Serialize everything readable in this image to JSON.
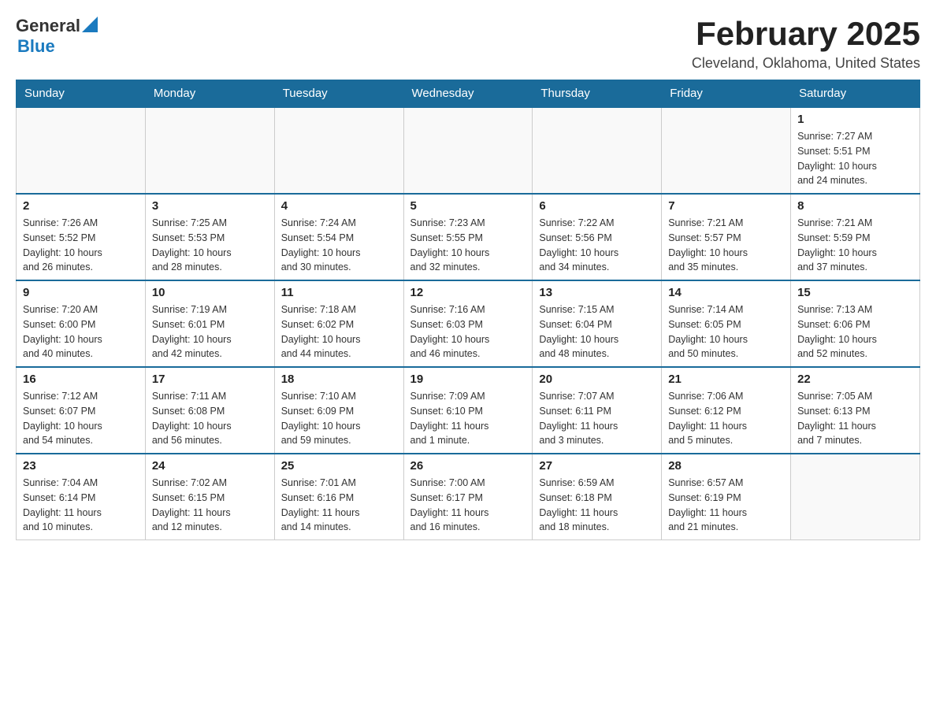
{
  "header": {
    "logo_general": "General",
    "logo_blue": "Blue",
    "title": "February 2025",
    "location": "Cleveland, Oklahoma, United States"
  },
  "days_of_week": [
    "Sunday",
    "Monday",
    "Tuesday",
    "Wednesday",
    "Thursday",
    "Friday",
    "Saturday"
  ],
  "weeks": [
    [
      {
        "day": "",
        "info": ""
      },
      {
        "day": "",
        "info": ""
      },
      {
        "day": "",
        "info": ""
      },
      {
        "day": "",
        "info": ""
      },
      {
        "day": "",
        "info": ""
      },
      {
        "day": "",
        "info": ""
      },
      {
        "day": "1",
        "info": "Sunrise: 7:27 AM\nSunset: 5:51 PM\nDaylight: 10 hours\nand 24 minutes."
      }
    ],
    [
      {
        "day": "2",
        "info": "Sunrise: 7:26 AM\nSunset: 5:52 PM\nDaylight: 10 hours\nand 26 minutes."
      },
      {
        "day": "3",
        "info": "Sunrise: 7:25 AM\nSunset: 5:53 PM\nDaylight: 10 hours\nand 28 minutes."
      },
      {
        "day": "4",
        "info": "Sunrise: 7:24 AM\nSunset: 5:54 PM\nDaylight: 10 hours\nand 30 minutes."
      },
      {
        "day": "5",
        "info": "Sunrise: 7:23 AM\nSunset: 5:55 PM\nDaylight: 10 hours\nand 32 minutes."
      },
      {
        "day": "6",
        "info": "Sunrise: 7:22 AM\nSunset: 5:56 PM\nDaylight: 10 hours\nand 34 minutes."
      },
      {
        "day": "7",
        "info": "Sunrise: 7:21 AM\nSunset: 5:57 PM\nDaylight: 10 hours\nand 35 minutes."
      },
      {
        "day": "8",
        "info": "Sunrise: 7:21 AM\nSunset: 5:59 PM\nDaylight: 10 hours\nand 37 minutes."
      }
    ],
    [
      {
        "day": "9",
        "info": "Sunrise: 7:20 AM\nSunset: 6:00 PM\nDaylight: 10 hours\nand 40 minutes."
      },
      {
        "day": "10",
        "info": "Sunrise: 7:19 AM\nSunset: 6:01 PM\nDaylight: 10 hours\nand 42 minutes."
      },
      {
        "day": "11",
        "info": "Sunrise: 7:18 AM\nSunset: 6:02 PM\nDaylight: 10 hours\nand 44 minutes."
      },
      {
        "day": "12",
        "info": "Sunrise: 7:16 AM\nSunset: 6:03 PM\nDaylight: 10 hours\nand 46 minutes."
      },
      {
        "day": "13",
        "info": "Sunrise: 7:15 AM\nSunset: 6:04 PM\nDaylight: 10 hours\nand 48 minutes."
      },
      {
        "day": "14",
        "info": "Sunrise: 7:14 AM\nSunset: 6:05 PM\nDaylight: 10 hours\nand 50 minutes."
      },
      {
        "day": "15",
        "info": "Sunrise: 7:13 AM\nSunset: 6:06 PM\nDaylight: 10 hours\nand 52 minutes."
      }
    ],
    [
      {
        "day": "16",
        "info": "Sunrise: 7:12 AM\nSunset: 6:07 PM\nDaylight: 10 hours\nand 54 minutes."
      },
      {
        "day": "17",
        "info": "Sunrise: 7:11 AM\nSunset: 6:08 PM\nDaylight: 10 hours\nand 56 minutes."
      },
      {
        "day": "18",
        "info": "Sunrise: 7:10 AM\nSunset: 6:09 PM\nDaylight: 10 hours\nand 59 minutes."
      },
      {
        "day": "19",
        "info": "Sunrise: 7:09 AM\nSunset: 6:10 PM\nDaylight: 11 hours\nand 1 minute."
      },
      {
        "day": "20",
        "info": "Sunrise: 7:07 AM\nSunset: 6:11 PM\nDaylight: 11 hours\nand 3 minutes."
      },
      {
        "day": "21",
        "info": "Sunrise: 7:06 AM\nSunset: 6:12 PM\nDaylight: 11 hours\nand 5 minutes."
      },
      {
        "day": "22",
        "info": "Sunrise: 7:05 AM\nSunset: 6:13 PM\nDaylight: 11 hours\nand 7 minutes."
      }
    ],
    [
      {
        "day": "23",
        "info": "Sunrise: 7:04 AM\nSunset: 6:14 PM\nDaylight: 11 hours\nand 10 minutes."
      },
      {
        "day": "24",
        "info": "Sunrise: 7:02 AM\nSunset: 6:15 PM\nDaylight: 11 hours\nand 12 minutes."
      },
      {
        "day": "25",
        "info": "Sunrise: 7:01 AM\nSunset: 6:16 PM\nDaylight: 11 hours\nand 14 minutes."
      },
      {
        "day": "26",
        "info": "Sunrise: 7:00 AM\nSunset: 6:17 PM\nDaylight: 11 hours\nand 16 minutes."
      },
      {
        "day": "27",
        "info": "Sunrise: 6:59 AM\nSunset: 6:18 PM\nDaylight: 11 hours\nand 18 minutes."
      },
      {
        "day": "28",
        "info": "Sunrise: 6:57 AM\nSunset: 6:19 PM\nDaylight: 11 hours\nand 21 minutes."
      },
      {
        "day": "",
        "info": ""
      }
    ]
  ]
}
